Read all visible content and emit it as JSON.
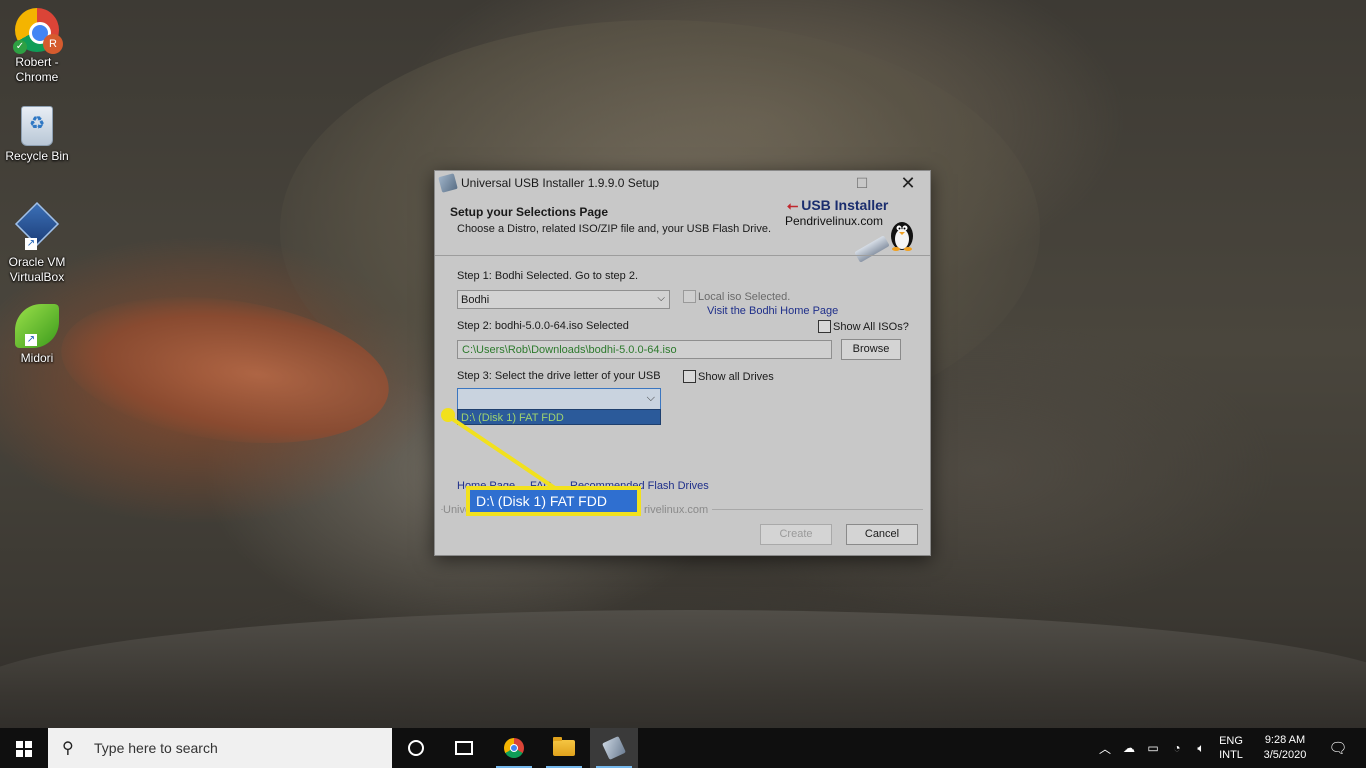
{
  "desktop": {
    "icons": [
      {
        "label": "Robert - Chrome",
        "badge": "R",
        "icon": "chrome-icon"
      },
      {
        "label": "Recycle Bin",
        "icon": "recycle-bin-icon"
      },
      {
        "label": "Oracle VM VirtualBox",
        "icon": "virtualbox-icon"
      },
      {
        "label": "Midori",
        "icon": "midori-icon"
      }
    ]
  },
  "dialog": {
    "title": "Universal USB Installer 1.9.9.0 Setup",
    "header_title": "Setup your Selections Page",
    "header_subtitle": "Choose a Distro, related ISO/ZIP file and, your USB Flash Drive.",
    "logo_title": "USB Installer",
    "logo_site": "Pendrivelinux.com",
    "step1_label": "Step 1: Bodhi Selected. Go to step 2.",
    "distro_value": "Bodhi",
    "local_iso_label": "Local iso Selected.",
    "home_page_link": "Visit the Bodhi Home Page",
    "step2_label": "Step 2: bodhi-5.0.0-64.iso Selected",
    "show_all_isos_label": "Show All ISOs?",
    "iso_path": "C:\\Users\\Rob\\Downloads\\bodhi-5.0.0-64.iso",
    "browse_label": "Browse",
    "step3_label": "Step 3: Select the drive letter of your USB",
    "show_all_drives_label": "Show all Drives",
    "drive_value": "",
    "drive_options": [
      "D:\\ (Disk 1)   FAT FDD"
    ],
    "footer_link_home": "Home Page",
    "footer_link_faq": "FAQ",
    "footer_link_flash": "Recommended Flash Drives",
    "footer_brand_left": "Unive",
    "footer_brand_right": "rivelinux.com",
    "create_label": "Create",
    "cancel_label": "Cancel"
  },
  "callout": {
    "text": "D:\\ (Disk 1)   FAT FDD",
    "color": "#f2e11d"
  },
  "taskbar": {
    "search_placeholder": "Type here to search",
    "lang_line1": "ENG",
    "lang_line2": "INTL",
    "time": "9:28 AM",
    "date": "3/5/2020"
  }
}
